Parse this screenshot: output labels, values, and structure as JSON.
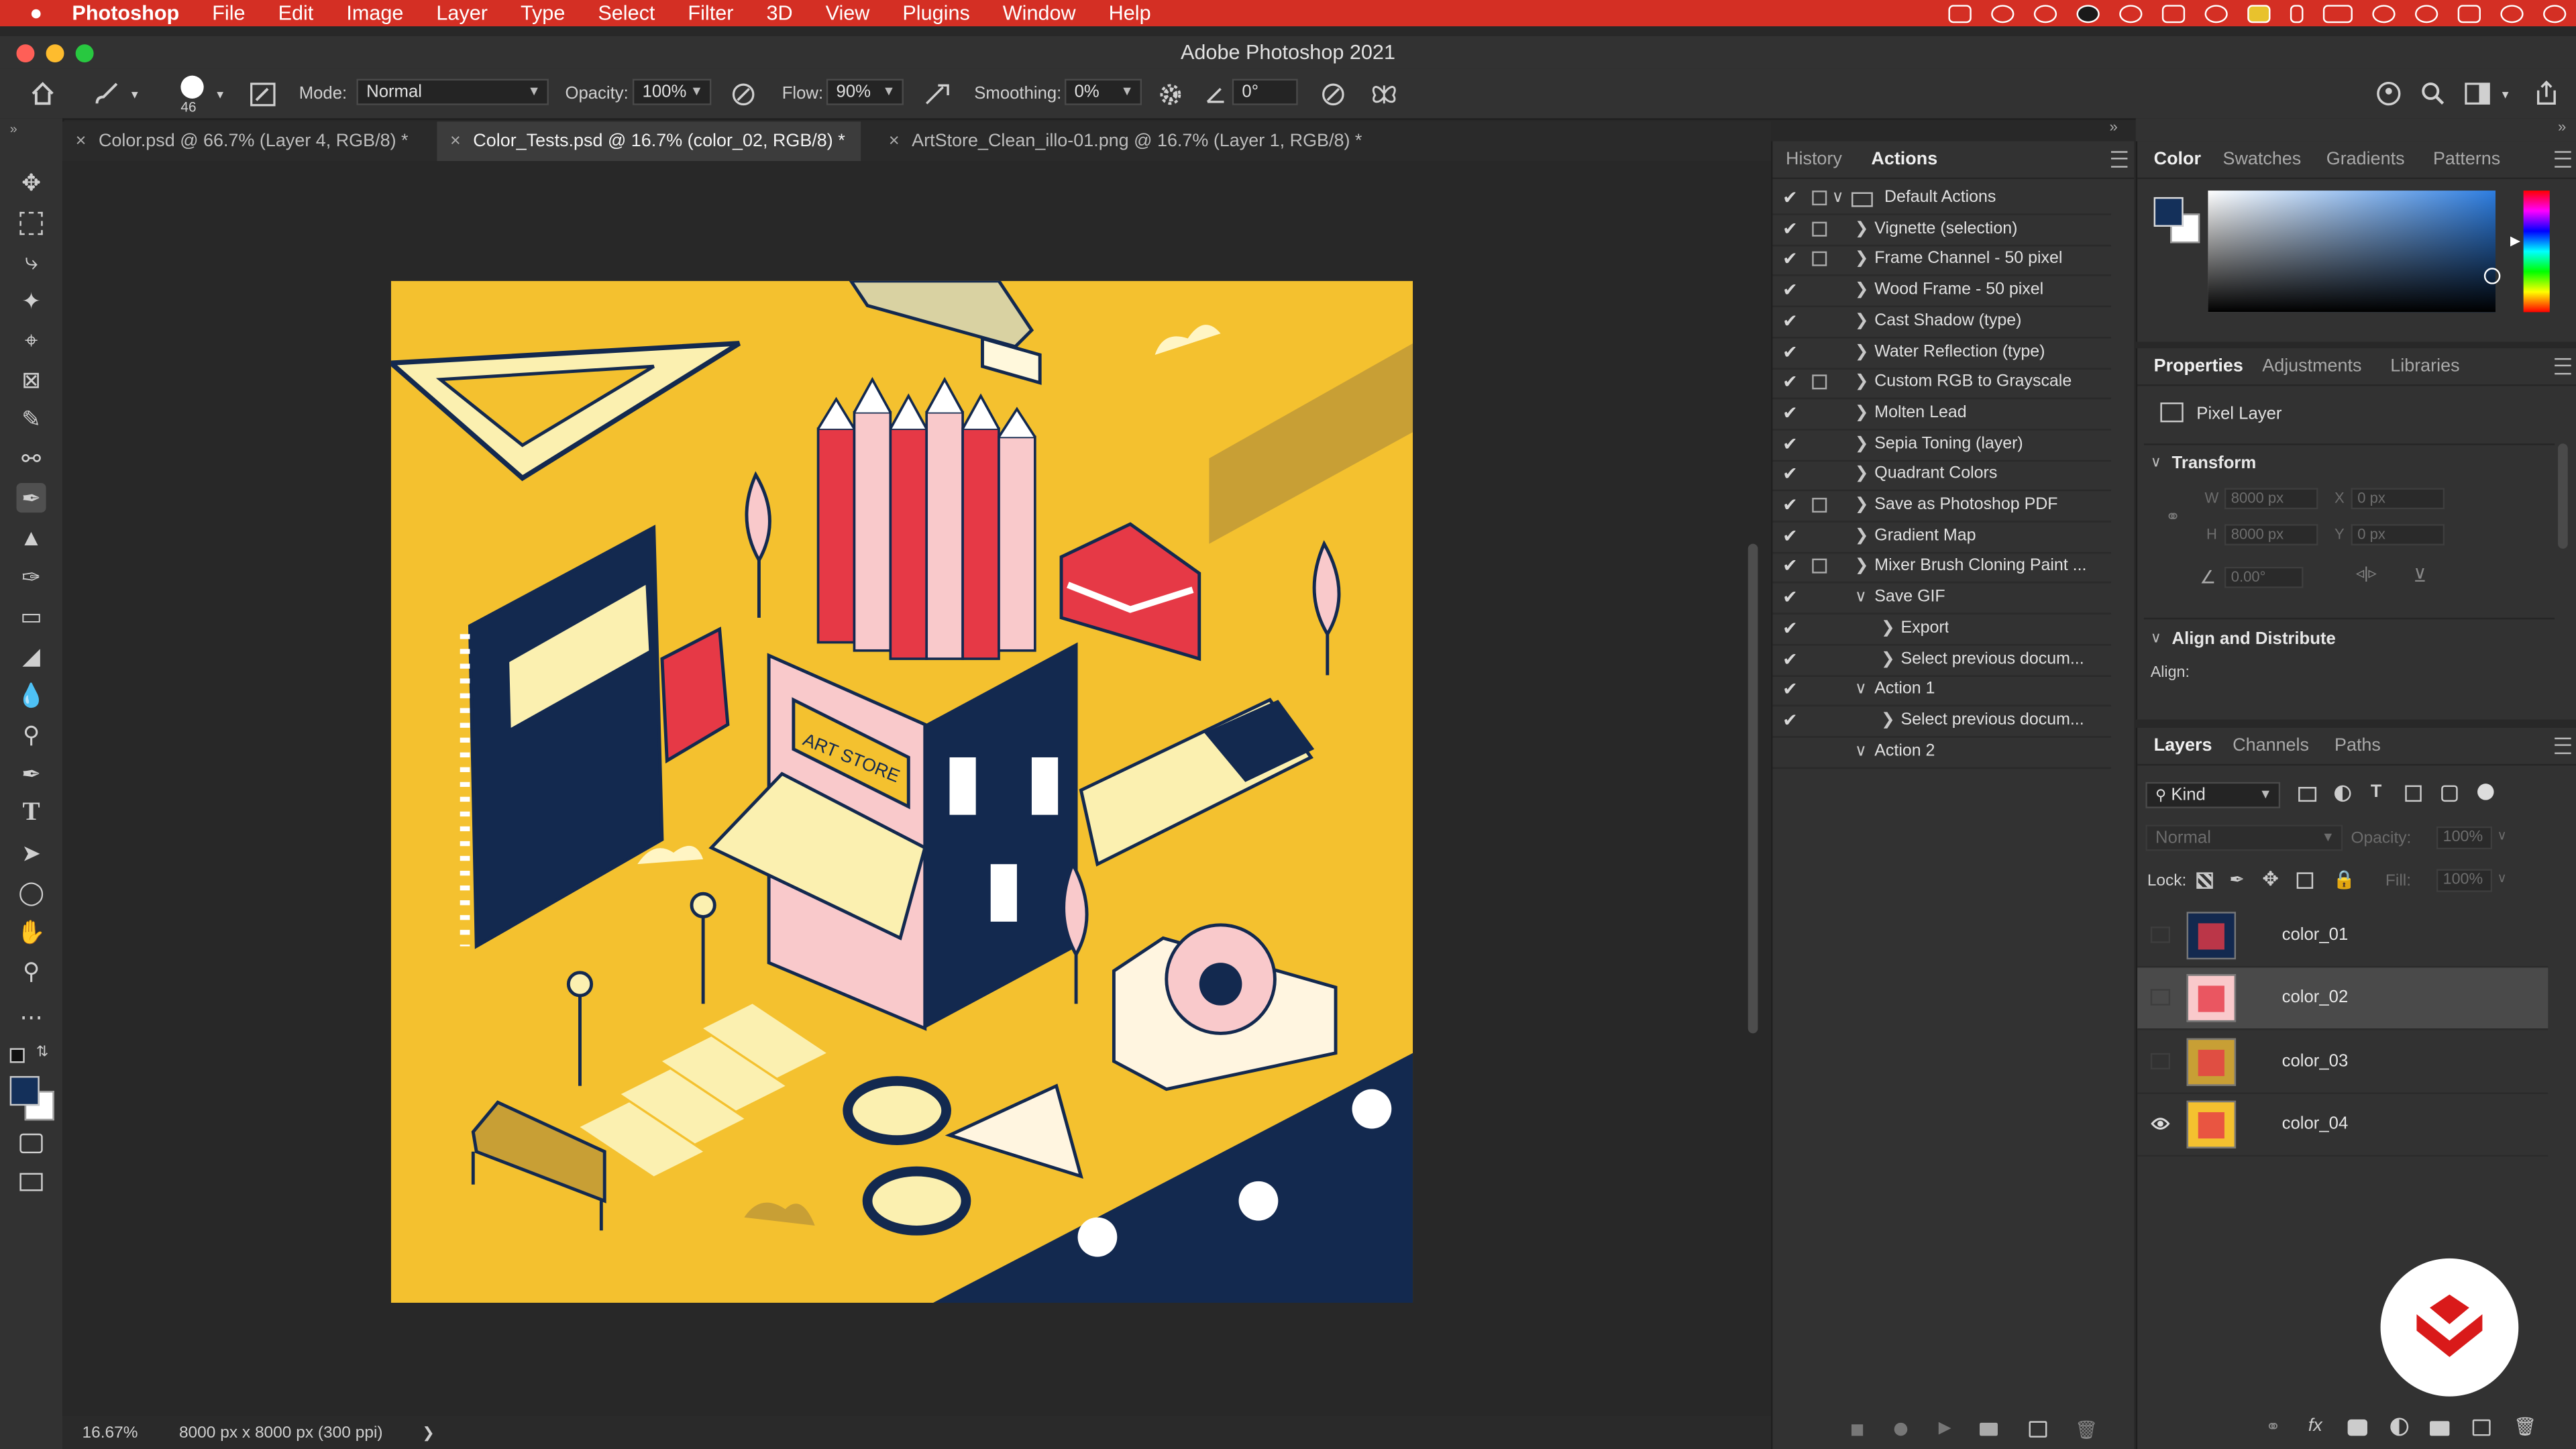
{
  "menubar": {
    "app_name": "Photoshop",
    "items": [
      "File",
      "Edit",
      "Image",
      "Layer",
      "Type",
      "Select",
      "Filter",
      "3D",
      "View",
      "Plugins",
      "Window",
      "Help"
    ]
  },
  "window": {
    "title": "Adobe Photoshop 2021"
  },
  "options": {
    "brush_size": "46",
    "mode_label": "Mode:",
    "mode_value": "Normal",
    "opacity_label": "Opacity:",
    "opacity_value": "100%",
    "flow_label": "Flow:",
    "flow_value": "90%",
    "smoothing_label": "Smoothing:",
    "smoothing_value": "0%",
    "angle_value": "0°"
  },
  "tabs": [
    {
      "label": "Color.psd @ 66.7% (Layer 4, RGB/8) *"
    },
    {
      "label": "Color_Tests.psd @ 16.7% (color_02, RGB/8) *"
    },
    {
      "label": "ArtStore_Clean_illo-01.png @ 16.7% (Layer 1, RGB/8) *"
    }
  ],
  "canvas": {
    "sign_text": "ART STORE"
  },
  "status": {
    "zoom": "16.67%",
    "doc_info": "8000 px x 8000 px (300 ppi)",
    "arrow": "❯"
  },
  "history_panel": {
    "tabs": [
      "History",
      "Actions"
    ],
    "actions": [
      {
        "label": "Default Actions",
        "indent": 0,
        "open": true,
        "folder": true,
        "dialog": true
      },
      {
        "label": "Vignette (selection)",
        "indent": 1,
        "dialog": true
      },
      {
        "label": "Frame Channel - 50 pixel",
        "indent": 1,
        "dialog": true
      },
      {
        "label": "Wood Frame - 50 pixel",
        "indent": 1
      },
      {
        "label": "Cast Shadow (type)",
        "indent": 1
      },
      {
        "label": "Water Reflection (type)",
        "indent": 1
      },
      {
        "label": "Custom RGB to Grayscale",
        "indent": 1,
        "dialog": true
      },
      {
        "label": "Molten Lead",
        "indent": 1
      },
      {
        "label": "Sepia Toning (layer)",
        "indent": 1
      },
      {
        "label": "Quadrant Colors",
        "indent": 1
      },
      {
        "label": "Save as Photoshop PDF",
        "indent": 1,
        "dialog": true
      },
      {
        "label": "Gradient Map",
        "indent": 1
      },
      {
        "label": "Mixer Brush Cloning Paint ...",
        "indent": 1,
        "dialog": true
      },
      {
        "label": "Save GIF",
        "indent": 1,
        "open": true
      },
      {
        "label": "Export",
        "indent": 2
      },
      {
        "label": "Select previous docum...",
        "indent": 2
      },
      {
        "label": "Action 1",
        "indent": 1,
        "open": true
      },
      {
        "label": "Select previous docum...",
        "indent": 2
      },
      {
        "label": "Action 2",
        "indent": 1,
        "open": true,
        "nocheck": true
      }
    ]
  },
  "color_panel": {
    "tabs": [
      "Color",
      "Swatches",
      "Gradients",
      "Patterns"
    ],
    "foreground": "#14305a",
    "background": "#ffffff"
  },
  "properties_panel": {
    "tabs": [
      "Properties",
      "Adjustments",
      "Libraries"
    ],
    "layer_type": "Pixel Layer",
    "transform_title": "Transform",
    "w_label": "W",
    "w_value": "8000 px",
    "x_label": "X",
    "x_value": "0 px",
    "h_label": "H",
    "h_value": "8000 px",
    "y_label": "Y",
    "y_value": "0 px",
    "angle_value": "0.00°",
    "align_title": "Align and Distribute",
    "align_label": "Align:"
  },
  "layers_panel": {
    "tabs": [
      "Layers",
      "Channels",
      "Paths"
    ],
    "filter_value": "Kind",
    "blend_value": "Normal",
    "opacity_label": "Opacity:",
    "opacity_value": "100%",
    "lock_label": "Lock:",
    "fill_label": "Fill:",
    "fill_value": "100%",
    "layers": [
      {
        "name": "color_01",
        "visible": false,
        "selected": false
      },
      {
        "name": "color_02",
        "visible": false,
        "selected": true
      },
      {
        "name": "color_03",
        "visible": false,
        "selected": false
      },
      {
        "name": "color_04",
        "visible": true,
        "selected": false
      }
    ]
  }
}
